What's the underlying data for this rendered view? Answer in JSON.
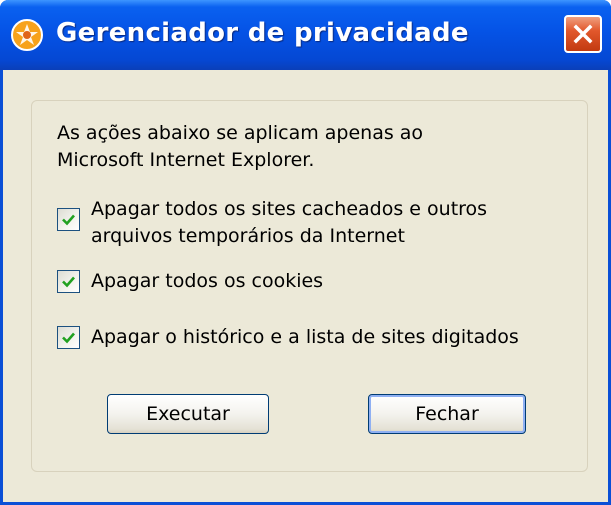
{
  "window": {
    "title": "Gerenciador de privacidade"
  },
  "content": {
    "intro_line1": "As ações abaixo se aplicam apenas ao",
    "intro_line2": "Microsoft Internet Explorer.",
    "options": [
      {
        "line1": "Apagar todos os sites cacheados e outros",
        "line2": "arquivos temporários da Internet",
        "checked": true
      },
      {
        "line1": "Apagar todos os cookies",
        "checked": true
      },
      {
        "line1": "Apagar o histórico e a lista de sites digitados",
        "checked": true
      }
    ]
  },
  "buttons": {
    "execute_label": "Executar",
    "close_label": "Fechar"
  },
  "icons": {
    "app": "app-icon",
    "close": "close-icon",
    "checkmark": "checkmark-icon"
  },
  "colors": {
    "titlebar": "#0553e6",
    "window_bg": "#ece9d8",
    "close_button": "#e2582c",
    "checkmark": "#21a121"
  }
}
